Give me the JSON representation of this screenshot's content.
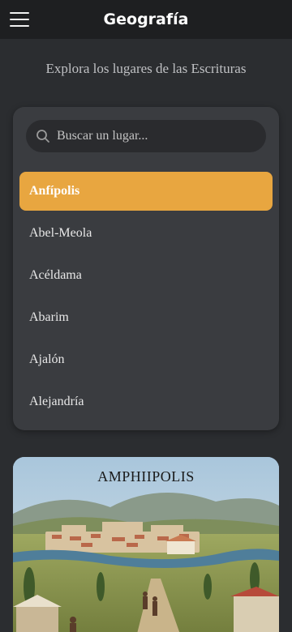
{
  "header": {
    "title": "Geografía",
    "menu_icon": "hamburger-menu-icon"
  },
  "subtitle": "Explora los lugares de las Escrituras",
  "search": {
    "placeholder": "Buscar un lugar...",
    "icon": "search-icon"
  },
  "places": [
    {
      "label": "Anfípolis",
      "selected": true
    },
    {
      "label": "Abel-Meola",
      "selected": false
    },
    {
      "label": "Acéldama",
      "selected": false
    },
    {
      "label": "Abarim",
      "selected": false
    },
    {
      "label": "Ajalón",
      "selected": false
    },
    {
      "label": "Alejandría",
      "selected": false
    }
  ],
  "card": {
    "image_caption": "AMPHIIPOLIS"
  },
  "colors": {
    "accent": "#e8a640",
    "background": "#2b2d30",
    "panel": "#3a3c40",
    "topbar": "#1e1f21"
  }
}
